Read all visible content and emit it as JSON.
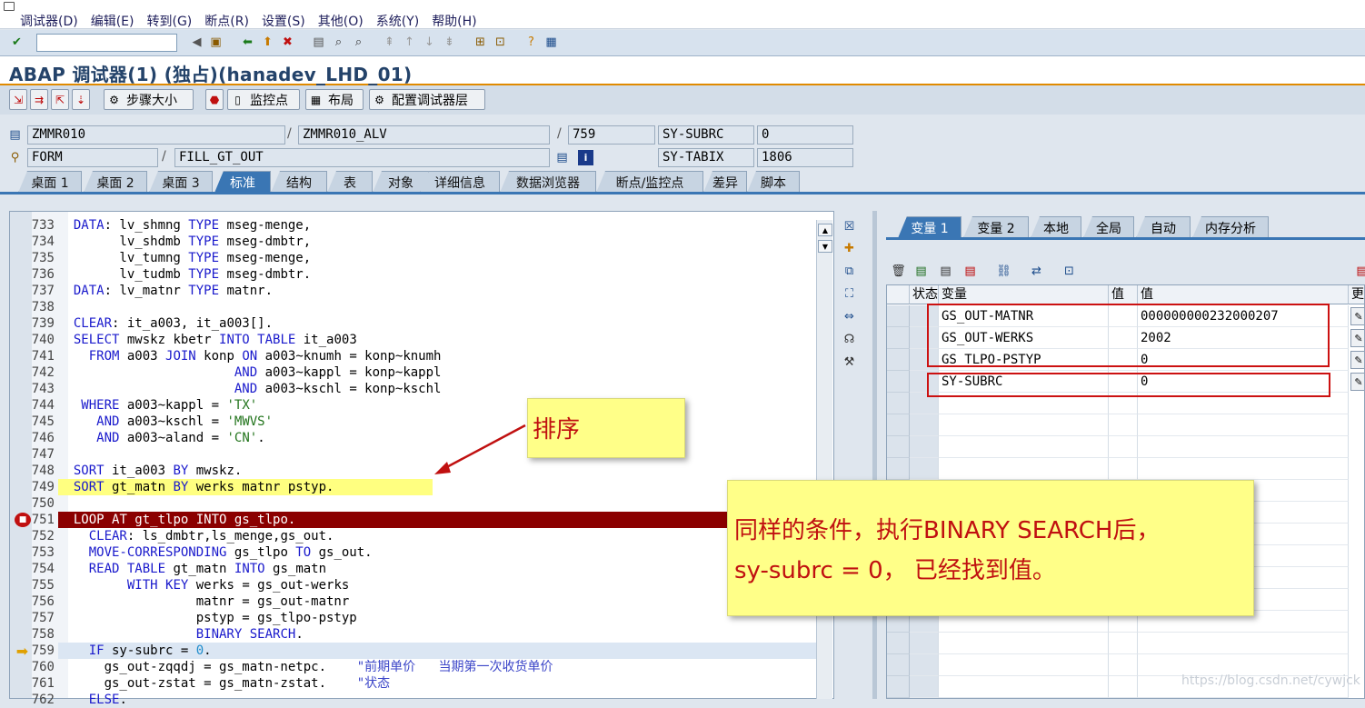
{
  "menu": {
    "items": [
      "调试器(D)",
      "编辑(E)",
      "转到(G)",
      "断点(R)",
      "设置(S)",
      "其他(O)",
      "系统(Y)",
      "帮助(H)"
    ]
  },
  "toolbar1": {
    "command_value": ""
  },
  "title": "ABAP 调试器(1)  (独占)(hanadev_LHD_01)",
  "toolbar2": {
    "step_size": "步骤大小",
    "watchpoint": "监控点",
    "layout": "布局",
    "config_layer": "配置调试器层"
  },
  "info": {
    "program": "ZMMR010",
    "include": "ZMMR010_ALV",
    "line": "759",
    "sy_subrc_label": "SY-SUBRC",
    "sy_subrc_value": "0",
    "event_type": "FORM",
    "event_name": "FILL_GT_OUT",
    "sy_tabix_label": "SY-TABIX",
    "sy_tabix_value": "1806",
    "sep1": "/",
    "sep2": "/"
  },
  "tabs": [
    "桌面 1",
    "桌面 2",
    "桌面 3",
    "标准",
    "结构",
    "表",
    "对象",
    "详细信息",
    "数据浏览器",
    "断点/监控点",
    "差异",
    "脚本"
  ],
  "code": {
    "lines": [
      {
        "no": "733",
        "text": "  DATA: lv_shmng TYPE mseg-menge,"
      },
      {
        "no": "734",
        "text": "        lv_shdmb TYPE mseg-dmbtr,"
      },
      {
        "no": "735",
        "text": "        lv_tumng TYPE mseg-menge,"
      },
      {
        "no": "736",
        "text": "        lv_tudmb TYPE mseg-dmbtr."
      },
      {
        "no": "737",
        "text": "  DATA: lv_matnr TYPE matnr."
      },
      {
        "no": "738",
        "text": ""
      },
      {
        "no": "739",
        "text": "  CLEAR: it_a003, it_a003[]."
      },
      {
        "no": "740",
        "text": "  SELECT mwskz kbetr INTO TABLE it_a003"
      },
      {
        "no": "741",
        "text": "    FROM a003 JOIN konp ON a003~knumh = konp~knumh"
      },
      {
        "no": "742",
        "text": "                       AND a003~kappl = konp~kappl"
      },
      {
        "no": "743",
        "text": "                       AND a003~kschl = konp~kschl"
      },
      {
        "no": "744",
        "text": "   WHERE a003~kappl = 'TX'"
      },
      {
        "no": "745",
        "text": "     AND a003~kschl = 'MWVS'"
      },
      {
        "no": "746",
        "text": "     AND a003~aland = 'CN'."
      },
      {
        "no": "747",
        "text": ""
      },
      {
        "no": "748",
        "text": "  SORT it_a003 BY mwskz."
      },
      {
        "no": "749",
        "text": "  SORT gt_matn BY werks matnr pstyp."
      },
      {
        "no": "750",
        "text": ""
      },
      {
        "no": "751",
        "text": "  LOOP AT gt_tlpo INTO gs_tlpo."
      },
      {
        "no": "752",
        "text": "    CLEAR: ls_dmbtr,ls_menge,gs_out."
      },
      {
        "no": "753",
        "text": "    MOVE-CORRESPONDING gs_tlpo TO gs_out."
      },
      {
        "no": "754",
        "text": "    READ TABLE gt_matn INTO gs_matn"
      },
      {
        "no": "755",
        "text": "         WITH KEY werks = gs_out-werks"
      },
      {
        "no": "756",
        "text": "                  matnr = gs_out-matnr"
      },
      {
        "no": "757",
        "text": "                  pstyp = gs_tlpo-pstyp"
      },
      {
        "no": "758",
        "text": "                  BINARY SEARCH."
      },
      {
        "no": "759",
        "text": "    IF sy-subrc = 0."
      },
      {
        "no": "760",
        "text": "      gs_out-zqqdj = gs_matn-netpc.    \"前期单价   当期第一次收货单价"
      },
      {
        "no": "761",
        "text": "      gs_out-zstat = gs_matn-zstat.    \"状态"
      },
      {
        "no": "762",
        "text": "    ELSE."
      }
    ]
  },
  "right_tabs": [
    "变量 1",
    "变量 2",
    "本地",
    "全局",
    "自动",
    "内存分析"
  ],
  "grid": {
    "headers": {
      "status": "状态",
      "variable": "变量",
      "val_short": "值",
      "value": "值",
      "change": "更改"
    },
    "rows": [
      {
        "variable": "GS_OUT-MATNR",
        "value": "000000000232000207"
      },
      {
        "variable": "GS_OUT-WERKS",
        "value": "2002"
      },
      {
        "variable": "GS_TLPO-PSTYP",
        "value": "0"
      },
      {
        "variable": "SY-SUBRC",
        "value": "0"
      }
    ]
  },
  "annotations": {
    "note1": "排序",
    "note2_line1": "同样的条件，执行BINARY SEARCH后，",
    "note2_line2": "sy-subrc = 0， 已经找到值。"
  },
  "watermark": "https://blog.csdn.net/cywjck",
  "colors": {
    "accent": "#3a76b4",
    "title": "#24436a",
    "breakpoint_line": "#8b0000",
    "highlight": "#ffff80",
    "note_bg": "#ffff88",
    "note_text": "#c01010",
    "red_box": "#cc1111"
  }
}
